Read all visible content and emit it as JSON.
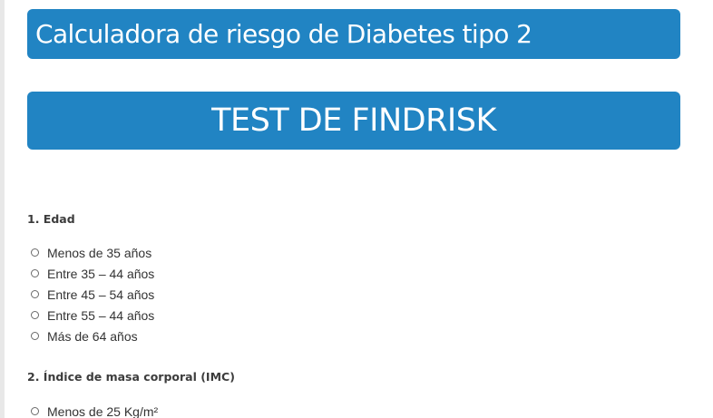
{
  "header": {
    "title": "Calculadora de riesgo de Diabetes tipo 2",
    "test_name": "TEST DE FINDRISK"
  },
  "colors": {
    "banner": "#2184c3",
    "banner_text": "#ffffff"
  },
  "questions": [
    {
      "label": "1. Edad",
      "options": [
        "Menos de 35 años",
        "Entre 35 – 44 años",
        "Entre 45 – 54 años",
        "Entre 55 – 44 años",
        "Más de 64 años"
      ]
    },
    {
      "label": "2. Índice de masa corporal (IMC)",
      "options": [
        "Menos de 25 Kg/m²"
      ]
    }
  ]
}
